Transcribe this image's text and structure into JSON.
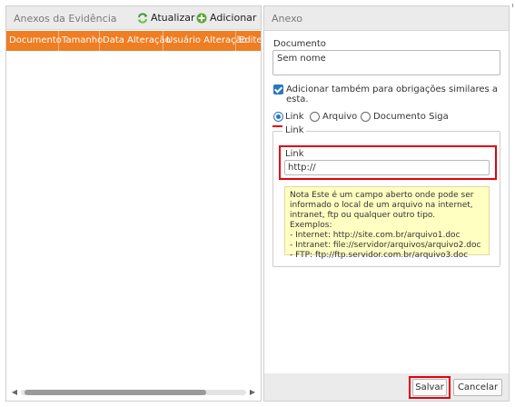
{
  "left_panel": {
    "title": "Anexos da Evidência",
    "refresh_label": "Atualizar",
    "add_label": "Adicionar",
    "columns": [
      "Documento",
      "Tamanho",
      "Data Alteração",
      "Usuário Alteração",
      "Edite"
    ],
    "rows": []
  },
  "right_panel": {
    "title": "Anexo",
    "document_label": "Documento",
    "document_value": "Sem nome",
    "similar_checkbox_label": "Adicionar também para obrigações similares a esta.",
    "similar_checked": true,
    "radio_options": [
      "Link",
      "Arquivo",
      "Documento Siga"
    ],
    "radio_selected": "Link",
    "fieldset_legend": "Link",
    "link_label": "Link",
    "link_value": "http://",
    "note_lines": [
      "Nota Este é um campo aberto onde pode ser",
      "informado o local de um arquivo na internet,",
      "intranet, ftp ou qualquer outro tipo.",
      "Exemplos:",
      "- Internet: http://site.com.br/arquivo1.doc",
      "- Intranet: file://servidor/arquivos/arquivo2.doc",
      "- FTP: ftp://ftp.servidor.com.br/arquivo3.doc"
    ]
  },
  "footer": {
    "save_label": "Salvar",
    "cancel_label": "Cancelar"
  },
  "colors": {
    "grid_header": "#ee7d23",
    "highlight": "#e3000f",
    "accent": "#2a75c6",
    "note_bg": "#ffffc2"
  },
  "icons": {
    "refresh": "refresh-icon",
    "add": "add-icon"
  }
}
